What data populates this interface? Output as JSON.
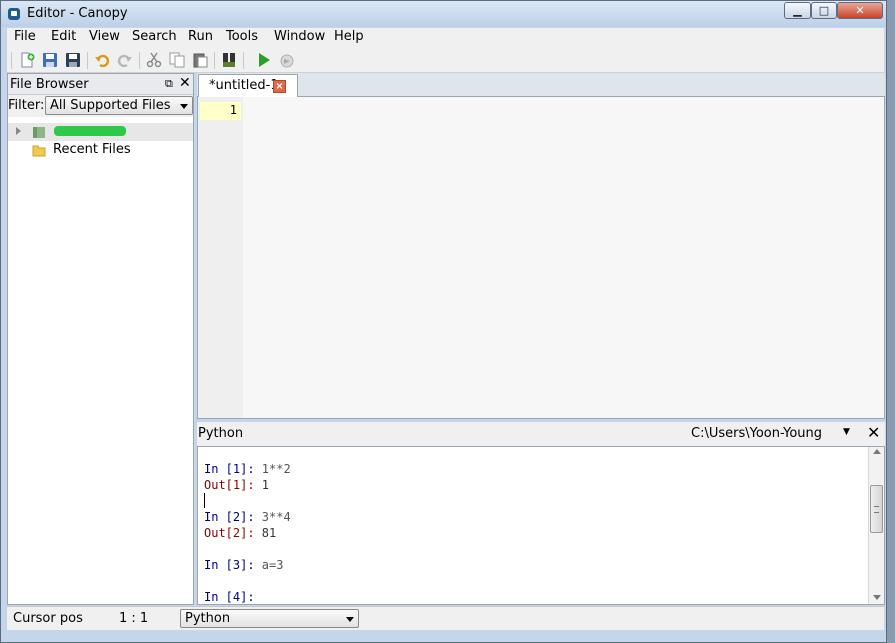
{
  "window": {
    "title": "Editor - Canopy",
    "minimize": "▁",
    "maximize": "□",
    "close": "✕"
  },
  "menu": [
    "File",
    "Edit",
    "View",
    "Search",
    "Run",
    "Tools",
    "Window",
    "Help"
  ],
  "toolbar": {
    "icons": [
      "new-file",
      "open-file",
      "save",
      "undo",
      "redo",
      "cut",
      "copy",
      "paste",
      "debug",
      "run",
      "run-disabled"
    ]
  },
  "file_browser": {
    "title": "File Browser",
    "filter_label": "Filter:",
    "filter_value": "All Supported Files",
    "tree": [
      {
        "label": "",
        "redacted": true,
        "expandable": true,
        "selected": true
      },
      {
        "label": "Recent Files",
        "redacted": false,
        "expandable": false,
        "selected": false
      }
    ]
  },
  "editor": {
    "tab_label": "*untitled-1",
    "line_numbers": [
      "1"
    ]
  },
  "console": {
    "title": "Python",
    "path": "C:\\Users\\Yoon-Young",
    "lines": [
      {
        "type": "in",
        "prompt": "In [1]: ",
        "code": "1**2"
      },
      {
        "type": "out",
        "prompt": "Out[1]: ",
        "code": "1"
      },
      {
        "type": "in",
        "prompt": "In [2]: ",
        "code": "3**4"
      },
      {
        "type": "out",
        "prompt": "Out[2]: ",
        "code": "81"
      },
      {
        "type": "in",
        "prompt": "In [3]: ",
        "code": "a=3"
      },
      {
        "type": "in",
        "prompt": "In [4]: ",
        "code": ""
      }
    ]
  },
  "status": {
    "label": "Cursor pos",
    "position": "1 : 1",
    "language": "Python"
  },
  "colors": {
    "accent": "#c5d6ea",
    "gutter_highlight": "#ffffc8",
    "close_red": "#c8452c",
    "run_green": "#2aa02a"
  }
}
